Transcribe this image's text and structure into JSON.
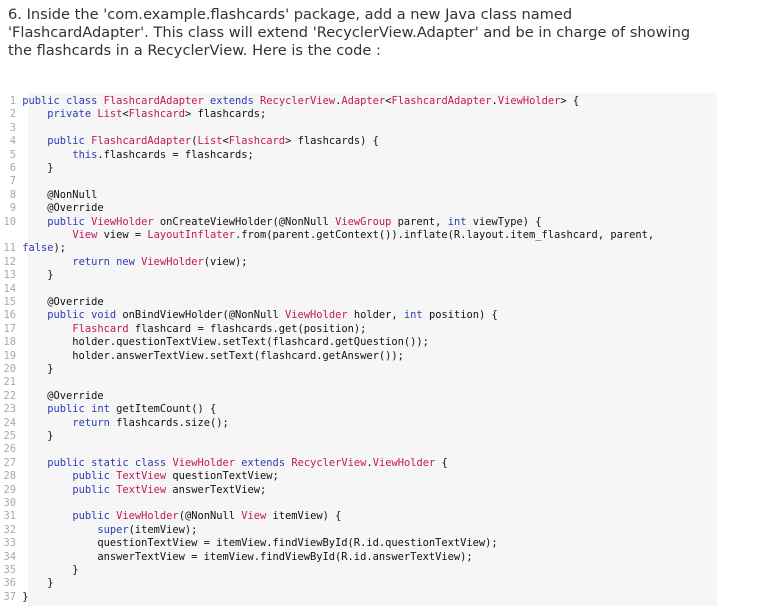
{
  "instructions": "6. Inside the 'com.example.flashcards' package, add a new Java class named 'FlashcardAdapter'. This class will extend 'RecyclerView.Adapter' and be in charge of showing the flashcards in a RecyclerView. Here is the code :",
  "code": {
    "lines": [
      {
        "n": "1",
        "text": " public class FlashcardAdapter extends RecyclerView.Adapter<FlashcardAdapter.ViewHolder> {"
      },
      {
        "n": "2",
        "text": "     private List<Flashcard> flashcards;"
      },
      {
        "n": "3",
        "text": ""
      },
      {
        "n": "4",
        "text": "     public FlashcardAdapter(List<Flashcard> flashcards) {"
      },
      {
        "n": "5",
        "text": "         this.flashcards = flashcards;"
      },
      {
        "n": "6",
        "text": "     }"
      },
      {
        "n": "7",
        "text": ""
      },
      {
        "n": "8",
        "text": "     @NonNull"
      },
      {
        "n": "9",
        "text": "     @Override"
      },
      {
        "n": "10",
        "text": "     public ViewHolder onCreateViewHolder(@NonNull ViewGroup parent, int viewType) {"
      },
      {
        "n": "",
        "text": "         View view = LayoutInflater.from(parent.getContext()).inflate(R.layout.item_flashcard, parent,"
      },
      {
        "n": "11",
        "text": " false);"
      },
      {
        "n": "12",
        "text": "         return new ViewHolder(view);"
      },
      {
        "n": "13",
        "text": "     }"
      },
      {
        "n": "14",
        "text": ""
      },
      {
        "n": "15",
        "text": "     @Override"
      },
      {
        "n": "16",
        "text": "     public void onBindViewHolder(@NonNull ViewHolder holder, int position) {"
      },
      {
        "n": "17",
        "text": "         Flashcard flashcard = flashcards.get(position);"
      },
      {
        "n": "18",
        "text": "         holder.questionTextView.setText(flashcard.getQuestion());"
      },
      {
        "n": "19",
        "text": "         holder.answerTextView.setText(flashcard.getAnswer());"
      },
      {
        "n": "20",
        "text": "     }"
      },
      {
        "n": "21",
        "text": ""
      },
      {
        "n": "22",
        "text": "     @Override"
      },
      {
        "n": "23",
        "text": "     public int getItemCount() {"
      },
      {
        "n": "24",
        "text": "         return flashcards.size();"
      },
      {
        "n": "25",
        "text": "     }"
      },
      {
        "n": "26",
        "text": ""
      },
      {
        "n": "27",
        "text": "     public static class ViewHolder extends RecyclerView.ViewHolder {"
      },
      {
        "n": "28",
        "text": "         public TextView questionTextView;"
      },
      {
        "n": "29",
        "text": "         public TextView answerTextView;"
      },
      {
        "n": "30",
        "text": ""
      },
      {
        "n": "31",
        "text": "         public ViewHolder(@NonNull View itemView) {"
      },
      {
        "n": "32",
        "text": "             super(itemView);"
      },
      {
        "n": "33",
        "text": "             questionTextView = itemView.findViewById(R.id.questionTextView);"
      },
      {
        "n": "34",
        "text": "             answerTextView = itemView.findViewById(R.id.answerTextView);"
      },
      {
        "n": "35",
        "text": "         }"
      },
      {
        "n": "36",
        "text": "     }"
      },
      {
        "n": "37",
        "text": " }"
      }
    ]
  },
  "colors": {
    "keyword": "#2e3bb4",
    "type": "#c2185b",
    "code_background": "#f6f6f6",
    "line_number": "#a8a8a8"
  }
}
